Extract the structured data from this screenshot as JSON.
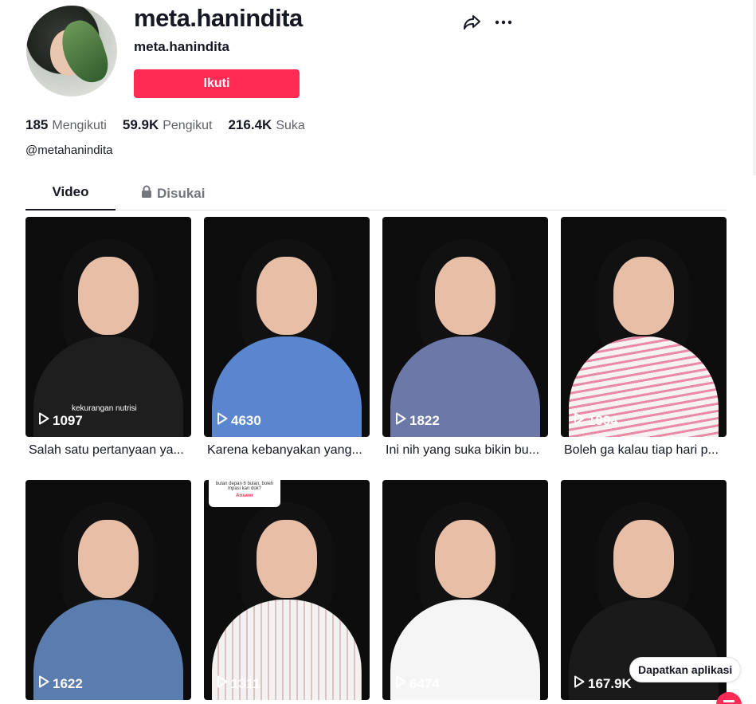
{
  "profile": {
    "username": "meta.hanindita",
    "nickname": "meta.hanindita",
    "follow_label": "Ikuti",
    "bio": "@metahanindita"
  },
  "stats": {
    "following_count": "185",
    "following_label": "Mengikuti",
    "followers_count": "59.9K",
    "followers_label": "Pengikut",
    "likes_count": "216.4K",
    "likes_label": "Suka"
  },
  "tabs": {
    "video_label": "Video",
    "liked_label": "Disukai"
  },
  "videos": [
    {
      "views": "1097",
      "caption": "Salah satu pertanyaan ya...",
      "overlay": "kekurangan nutrisi",
      "shirt_color": "#1e1e1e"
    },
    {
      "views": "4630",
      "caption": "Karena kebanyakan yang...",
      "overlay": "",
      "shirt_color": "#5a86cf"
    },
    {
      "views": "1822",
      "caption": "Ini nih yang suka bikin bu...",
      "overlay": "",
      "shirt_color": "#6c78a8"
    },
    {
      "views": "1994",
      "caption": "Boleh ga kalau tiap hari p...",
      "overlay": "",
      "shirt_color": "#f3b8c6"
    },
    {
      "views": "1622",
      "caption": "",
      "overlay": "",
      "shirt_color": "#5b7cae"
    },
    {
      "views": "1311",
      "caption": "",
      "overlay": "",
      "shirt_color": "#f2f2f2",
      "qa_text": "bulan depan 6 bulan, boleh mpasi kan dok?",
      "qa_answer": "Answer"
    },
    {
      "views": "6474",
      "caption": "",
      "overlay": "",
      "shirt_color": "#f5f5f5"
    },
    {
      "views": "167.9K",
      "caption": "",
      "overlay": "",
      "shirt_color": "#1a1a1a"
    }
  ],
  "get_app_label": "Dapatkan aplikasi",
  "colors": {
    "accent": "#fe2c55",
    "text_primary": "#161823",
    "text_secondary": "#73757c"
  },
  "icons": {
    "share": "share-arrow-icon",
    "more": "more-dots-icon",
    "lock": "lock-icon",
    "play": "play-icon"
  }
}
